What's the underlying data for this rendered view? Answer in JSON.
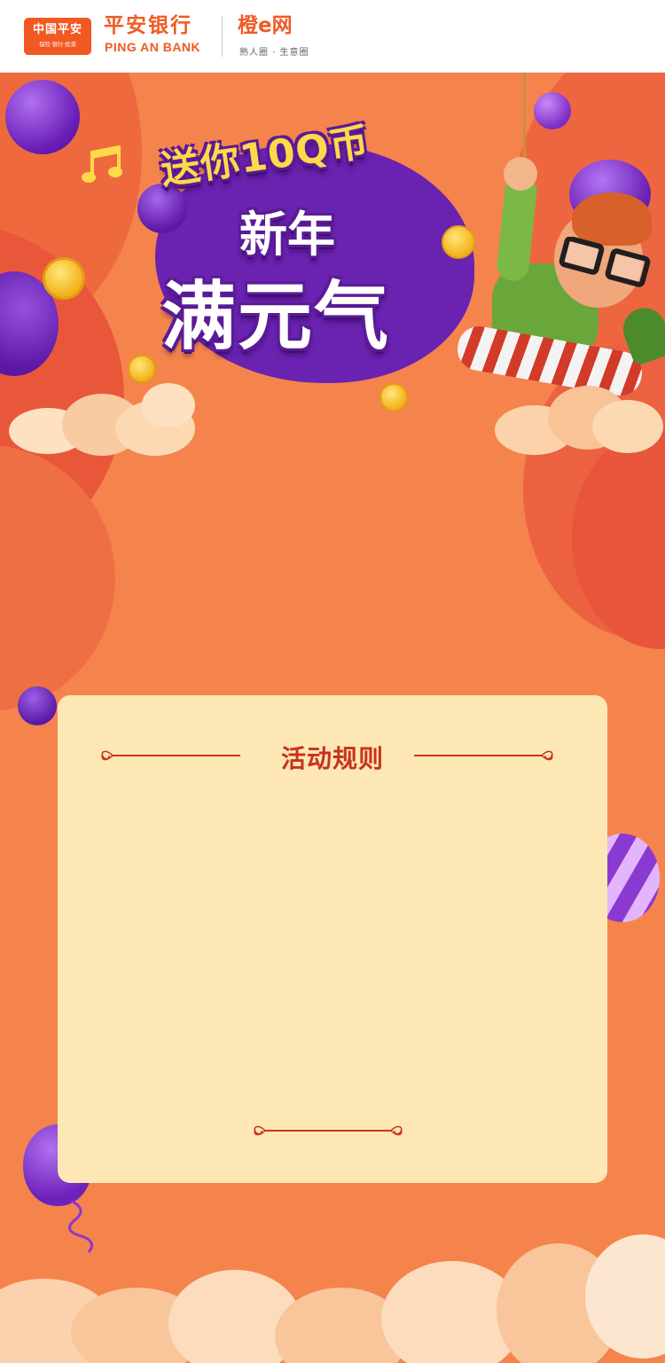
{
  "header": {
    "china_pingan_logo": "中国平安",
    "china_pingan_slogan": "保险·银行·投资",
    "bank_name": "平安银行",
    "bank_name_en": "PING AN BANK",
    "partner_name": "橙e网",
    "partner_tagline": "熟人圈 · 生意圈"
  },
  "banner": {
    "line1": "送你10Q币",
    "line2": "新年",
    "line3": "满元气"
  },
  "rules": {
    "title": "活动规则"
  },
  "colors": {
    "background": "#f5844c",
    "brand_orange": "#f05a22",
    "card": "#fde8b5",
    "rules_title": "#c8321e",
    "title_purple": "#5b1b96"
  }
}
